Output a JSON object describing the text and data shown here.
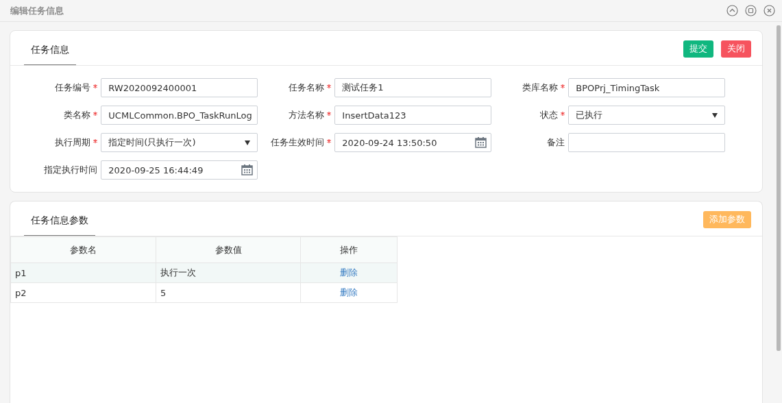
{
  "window": {
    "title": "编辑任务信息"
  },
  "info_panel": {
    "tab": "任务信息",
    "buttons": [
      {
        "label": "提交",
        "kind": "submit"
      },
      {
        "label": "关闭",
        "kind": "close"
      }
    ],
    "fields": [
      {
        "label": "任务编号",
        "required": true,
        "kind": "text",
        "value": "RW2020092400001"
      },
      {
        "label": "任务名称",
        "required": true,
        "kind": "text",
        "value": "测试任务1"
      },
      {
        "label": "类库名称",
        "required": true,
        "kind": "text",
        "value": "BPOPrj_TimingTask"
      },
      {
        "label": "类名称",
        "required": true,
        "kind": "text",
        "value": "UCMLCommon.BPO_TaskRunLog"
      },
      {
        "label": "方法名称",
        "required": true,
        "kind": "text",
        "value": "InsertData123"
      },
      {
        "label": "状态",
        "required": true,
        "kind": "select",
        "value": "已执行"
      },
      {
        "label": "执行周期",
        "required": true,
        "kind": "select",
        "value": "指定时间(只执行一次)"
      },
      {
        "label": "任务生效时间",
        "required": true,
        "kind": "date",
        "value": "2020-09-24 13:50:50"
      },
      {
        "label": "备注",
        "required": false,
        "kind": "text"
      },
      {
        "label": "指定执行时间",
        "required": false,
        "kind": "date",
        "value": "2020-09-25 16:44:49"
      }
    ]
  },
  "params_panel": {
    "tab": "任务信息参数",
    "buttons": [
      {
        "label": "添加参数",
        "kind": "add"
      }
    ],
    "table": {
      "columns": [
        "参数名",
        "参数值",
        "操作"
      ],
      "rows": [
        {
          "name": "p1",
          "value": "执行一次",
          "action": "删除",
          "selected": true
        },
        {
          "name": "p2",
          "value": "5",
          "action": "删除",
          "selected": false
        }
      ]
    }
  }
}
